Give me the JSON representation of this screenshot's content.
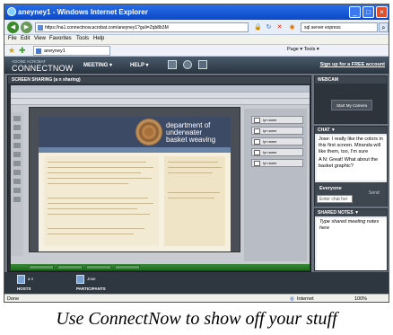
{
  "window": {
    "title": "aneyney1 - Windows Internet Explorer",
    "min_label": "_",
    "max_label": "□",
    "close_label": "×"
  },
  "address_bar": {
    "url": "https://na1.connectnow.acrobat.com/aneyney1?guli=Zqb8b3M",
    "search_text": "sql server express",
    "back_glyph": "◀",
    "forward_glyph": "▶",
    "search_glyph": "⌕"
  },
  "menu": [
    "File",
    "Edit",
    "View",
    "Favorites",
    "Tools",
    "Help"
  ],
  "favorites_bar": {
    "tab_label": "aneyney1",
    "tools": "Page ▾   Tools ▾"
  },
  "connect_header": {
    "logo_top": "ADOBE ACROBAT",
    "logo_main": "CONNECTNOW",
    "menus": [
      "MEETING ▾",
      "HELP ▾"
    ],
    "signup": "Sign up for a FREE account"
  },
  "screen_share": {
    "header": "SCREEN SHARING  (a n sharing)",
    "page_title_lines": [
      "department of",
      "underwater",
      "basket weaving"
    ],
    "layers": [
      "lyr name",
      "lyr name",
      "lyr name",
      "lyr name",
      "lyr name"
    ]
  },
  "webcam": {
    "header": "WEBCAM",
    "start_button": "Start My Camera"
  },
  "chat": {
    "header": "CHAT ▼",
    "messages": [
      "Jose: I really like the colors in this first screen. Miranda will like them, too, I'm sure",
      "A N: Great! What about the basket graphic?"
    ],
    "recipient": "Everyone",
    "input_placeholder": "Enter chat her",
    "send_label": "Send"
  },
  "shared_notes": {
    "header": "SHARED NOTES ▼",
    "placeholder": "Type shared meeting notes here"
  },
  "people": {
    "hosts_label": "HOSTS",
    "host_name": "a n",
    "participants_label": "PARTICIPANTS",
    "participant_name": "Jose"
  },
  "status_bar": {
    "left": "Done",
    "zone": "Internet",
    "zoom": "100%"
  },
  "caption": "Use ConnectNow to show off your stuff"
}
